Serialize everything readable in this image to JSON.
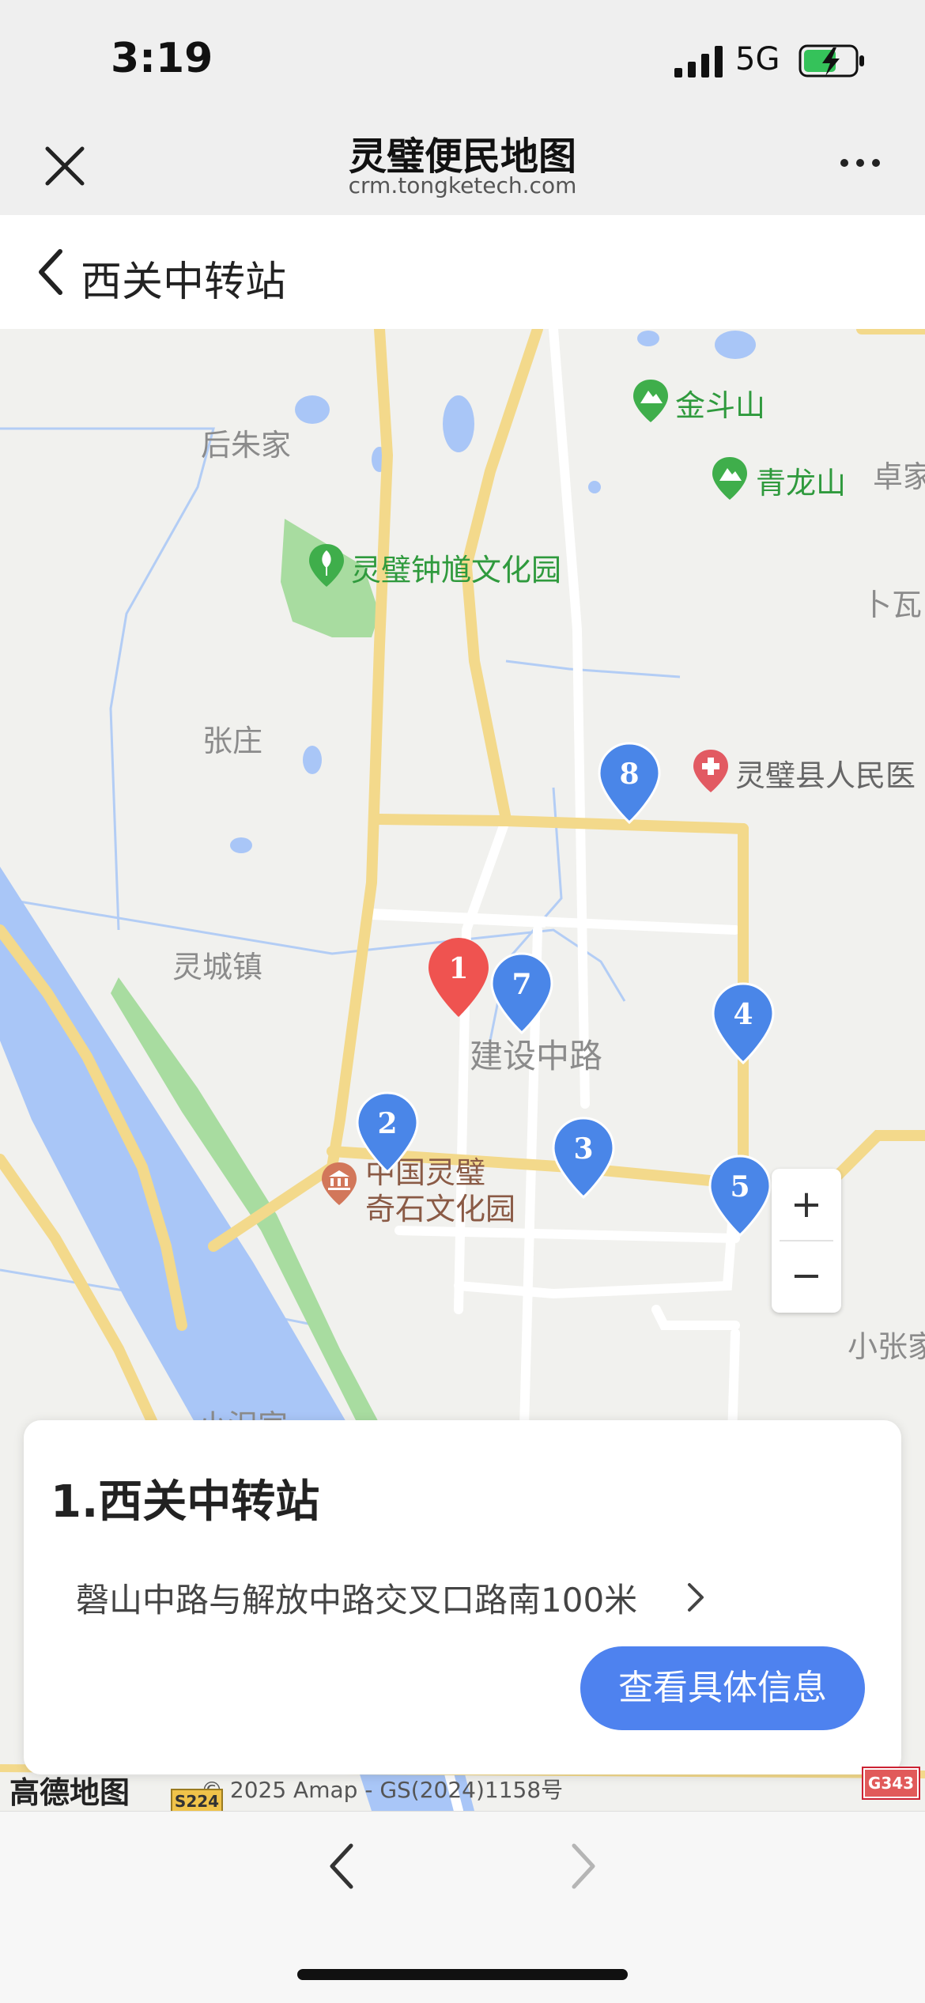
{
  "status": {
    "time": "3:19",
    "network": "5G"
  },
  "header": {
    "title": "灵璧便民地图",
    "url": "crm.tongketech.com"
  },
  "page": {
    "title": "西关中转站"
  },
  "map": {
    "place_labels": [
      "后朱家",
      "卓家",
      "卜瓦",
      "张庄",
      "灵城镇",
      "建设中路",
      "小张家",
      "小汜家"
    ],
    "poi_labels": {
      "jindoushan": "金斗山",
      "qinglongshan": "青龙山",
      "zhongkui": "灵璧钟馗文化园",
      "hospital": "灵璧县人民医",
      "qishi_1": "中国灵璧",
      "qishi_2": "奇石文化园"
    },
    "markers": [
      "1",
      "2",
      "3",
      "4",
      "5",
      "7",
      "8"
    ],
    "zoom_in": "+",
    "zoom_out": "−",
    "copyright": "© 2025 Amap - GS(2024)1158号",
    "logo_text": "高德地图",
    "road_badges": [
      "S224",
      "G343"
    ]
  },
  "card": {
    "title": "1.西关中转站",
    "address": "磬山中路与解放中路交叉口路南100米",
    "button": "查看具体信息"
  },
  "colors": {
    "accent": "#4e82ef",
    "selected_marker": "#ef5350",
    "marker": "#4a86e8"
  }
}
